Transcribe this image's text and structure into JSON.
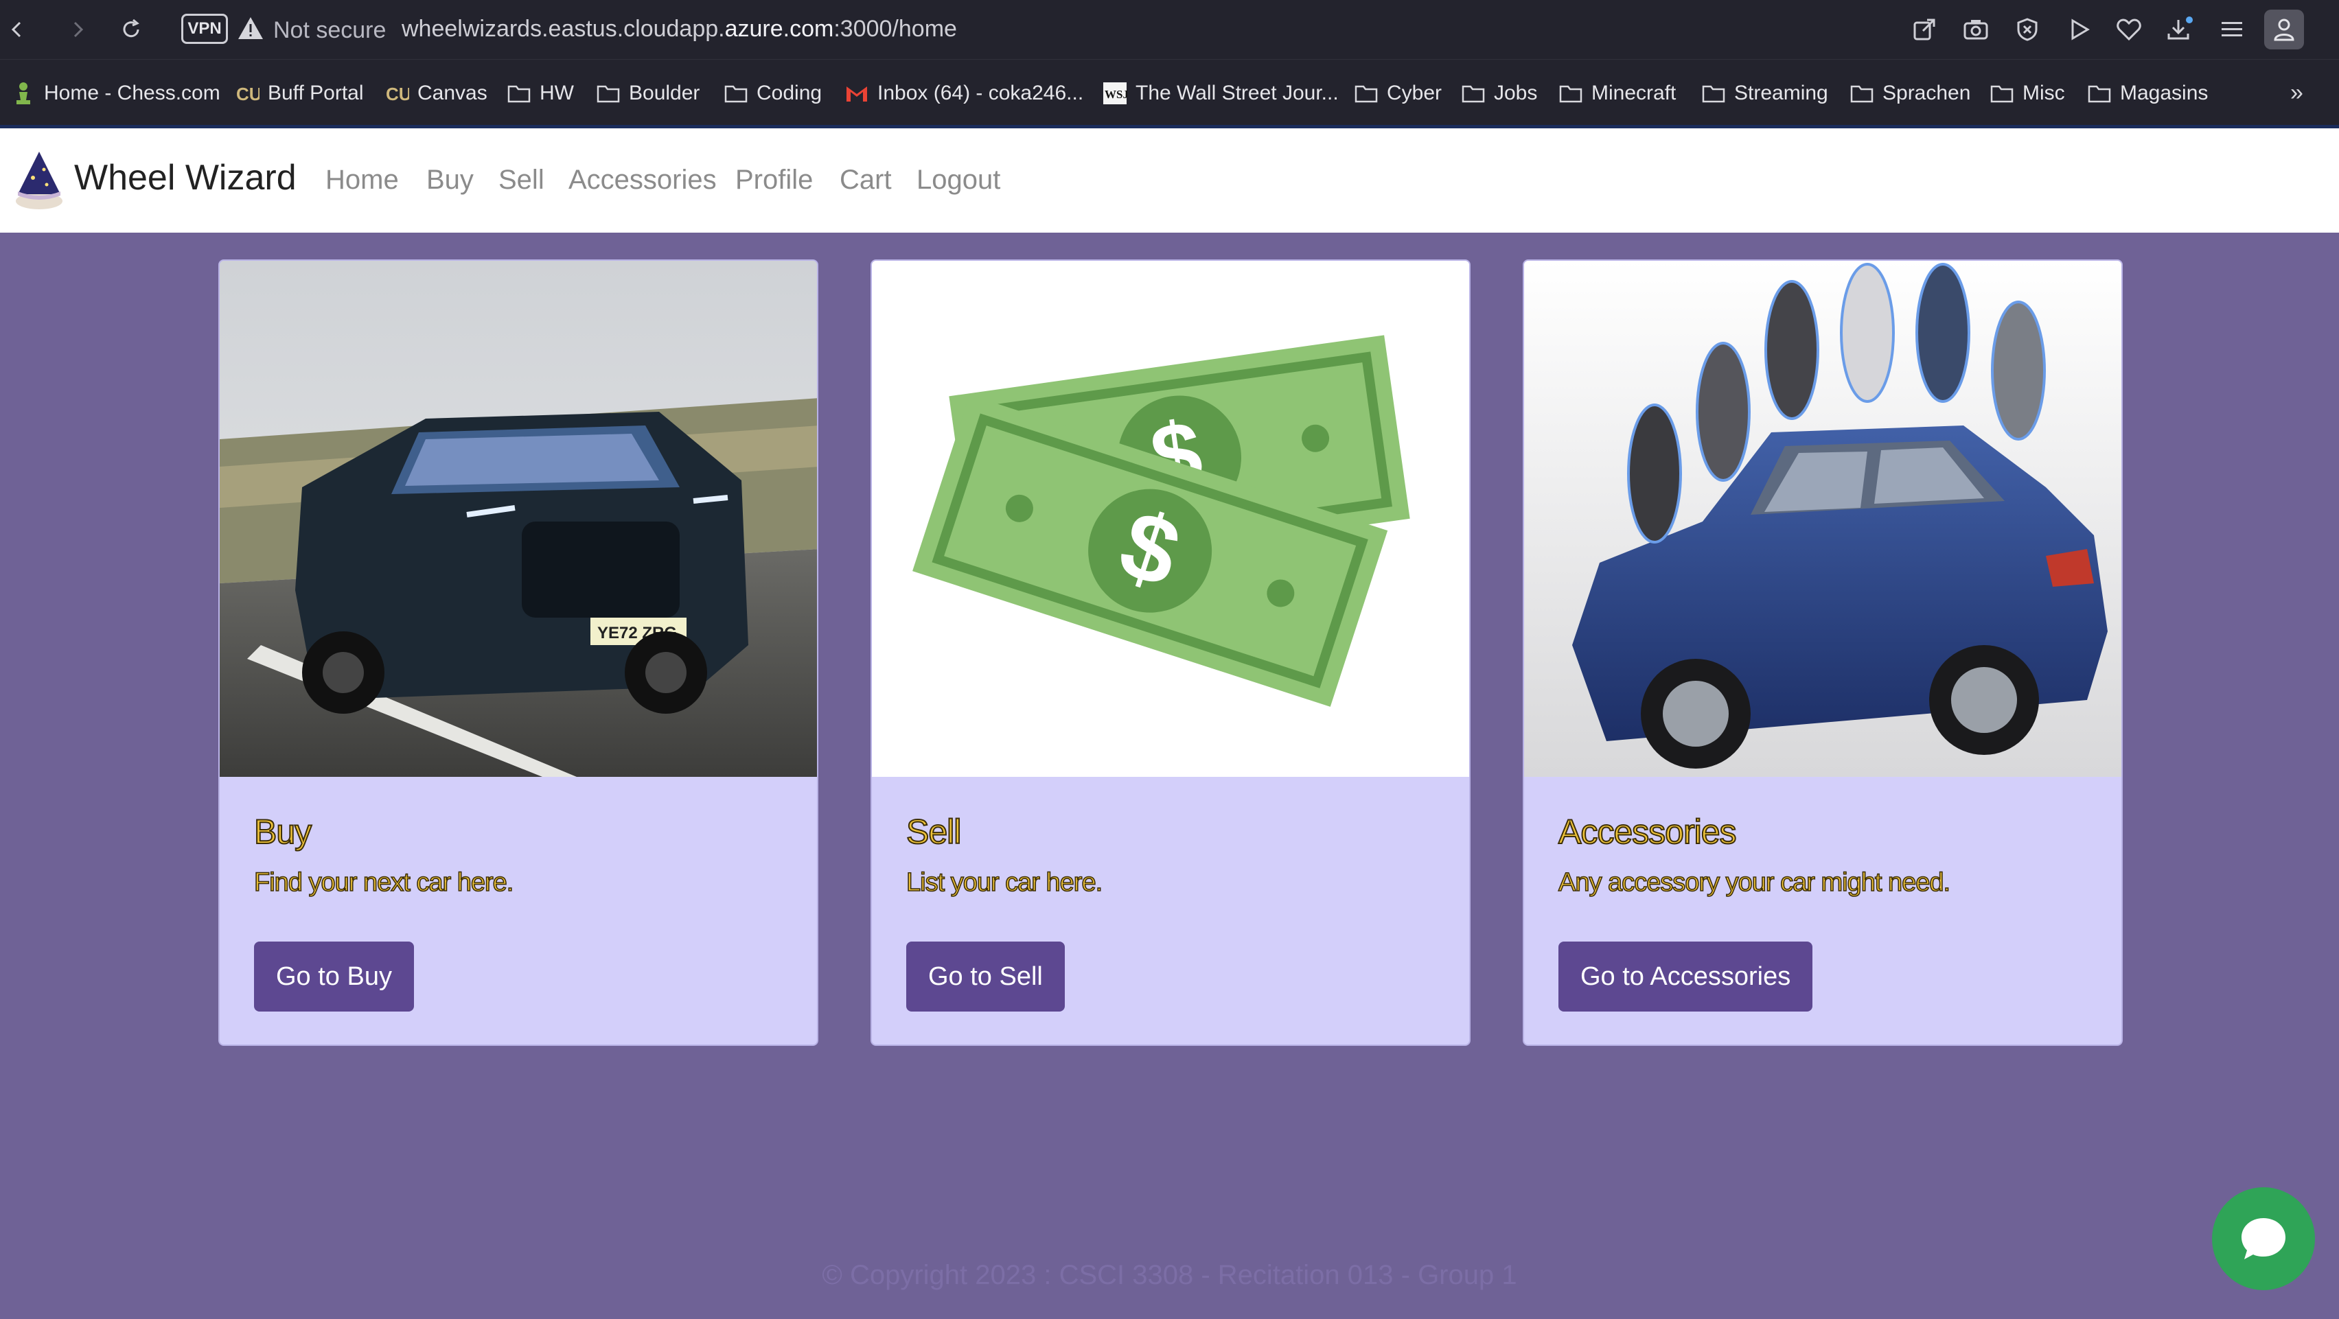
{
  "browser": {
    "vpn_label": "VPN",
    "security_label": "Not secure",
    "url_prefix": "wheelwizards.eastus.cloudapp.",
    "url_domain": "azure.com",
    "url_suffix": ":3000/home"
  },
  "bookmarks": [
    {
      "label": "Home - Chess.com",
      "icon": "pawn-icon"
    },
    {
      "label": "Buff Portal",
      "icon": "cu-logo-icon"
    },
    {
      "label": "Canvas",
      "icon": "cu-logo-icon"
    },
    {
      "label": "HW",
      "icon": "folder-icon"
    },
    {
      "label": "Boulder",
      "icon": "folder-icon"
    },
    {
      "label": "Coding",
      "icon": "folder-icon"
    },
    {
      "label": "Inbox (64) - coka246...",
      "icon": "gmail-icon"
    },
    {
      "label": "The Wall Street Jour...",
      "icon": "wsj-icon"
    },
    {
      "label": "Cyber",
      "icon": "folder-icon"
    },
    {
      "label": "Jobs",
      "icon": "folder-icon"
    },
    {
      "label": "Minecraft",
      "icon": "folder-icon"
    },
    {
      "label": "Streaming",
      "icon": "folder-icon"
    },
    {
      "label": "Sprachen",
      "icon": "folder-icon"
    },
    {
      "label": "Misc",
      "icon": "folder-icon"
    },
    {
      "label": "Magasins",
      "icon": "folder-icon"
    }
  ],
  "navbar": {
    "brand": "Wheel Wizard",
    "links": [
      "Home",
      "Buy",
      "Sell",
      "Accessories",
      "Profile",
      "Cart",
      "Logout"
    ]
  },
  "cards": [
    {
      "title": "Buy",
      "text": "Find your next car here.",
      "button": "Go to Buy"
    },
    {
      "title": "Sell",
      "text": "List your car here.",
      "button": "Go to Sell"
    },
    {
      "title": "Accessories",
      "text": "Any accessory your car might need.",
      "button": "Go to Accessories"
    }
  ],
  "footer": {
    "text": "© Copyright 2023 : CSCI 3308 - Recitation 013 - Group 1"
  },
  "colors": {
    "page_bg": "#6f6296",
    "card_bg": "#d3cffa",
    "button_bg": "#5d4891",
    "title_yellow": "#f0c43a",
    "chat_green": "#2fa457"
  }
}
